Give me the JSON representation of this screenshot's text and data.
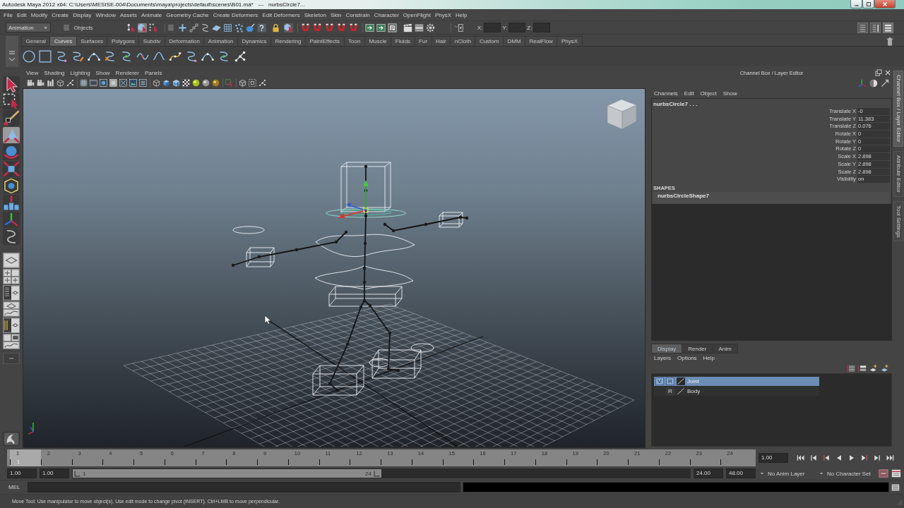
{
  "window": {
    "title": "Autodesk Maya 2012 x64: C:\\Users\\MESISE-004\\Documents\\maya\\projects\\default\\scenes\\B01.ma*   ---   nurbsCircle7..."
  },
  "menu_bar": [
    "File",
    "Edit",
    "Modify",
    "Create",
    "Display",
    "Window",
    "Assets",
    "Animate",
    "Geometry Cache",
    "Create Deformers",
    "Edit Deformers",
    "Skeleton",
    "Skin",
    "Constrain",
    "Character",
    "OpenFlight",
    "PhysX",
    "Help"
  ],
  "status_line": {
    "menu_set": "Animation",
    "selection_field": "Objects",
    "selection_modes": [
      {
        "kind": "hierarchy",
        "selected": false
      },
      {
        "kind": "object",
        "selected": true
      },
      {
        "kind": "component",
        "selected": false
      }
    ],
    "input_labels": [
      "X:",
      "Y:",
      "Z:"
    ]
  },
  "shelf": {
    "tabs": [
      {
        "label": "General",
        "selected": false
      },
      {
        "label": "Curves",
        "selected": true
      },
      {
        "label": "Surfaces",
        "selected": false
      },
      {
        "label": "Polygons",
        "selected": false
      },
      {
        "label": "Subdiv",
        "selected": false
      },
      {
        "label": "Deformation",
        "selected": false
      },
      {
        "label": "Animation",
        "selected": false
      },
      {
        "label": "Dynamics",
        "selected": false
      },
      {
        "label": "Rendering",
        "selected": false
      },
      {
        "label": "PaintEffects",
        "selected": false
      },
      {
        "label": "Toon",
        "selected": false
      },
      {
        "label": "Muscle",
        "selected": false
      },
      {
        "label": "Fluids",
        "selected": false
      },
      {
        "label": "Fur",
        "selected": false
      },
      {
        "label": "Hair",
        "selected": false
      },
      {
        "label": "nCloth",
        "selected": false
      },
      {
        "label": "Custom",
        "selected": false
      },
      {
        "label": "DMM",
        "selected": false
      },
      {
        "label": "RealFlow",
        "selected": false
      },
      {
        "label": "PhysX",
        "selected": false
      }
    ]
  },
  "toolbox": {
    "tools": [
      {
        "kind": "select",
        "selected": false
      },
      {
        "kind": "lasso",
        "selected": false
      },
      {
        "kind": "paint",
        "selected": false
      },
      {
        "kind": "move",
        "selected": true
      },
      {
        "kind": "rotate",
        "selected": false
      },
      {
        "kind": "scale",
        "selected": false
      },
      {
        "kind": "universal",
        "selected": false
      },
      {
        "kind": "soft-mod",
        "selected": false
      },
      {
        "kind": "show-manipulator",
        "selected": false
      },
      {
        "kind": "last-tool",
        "selected": false
      }
    ]
  },
  "viewport": {
    "menus": [
      "View",
      "Shading",
      "Lighting",
      "Show",
      "Renderer",
      "Panels"
    ]
  },
  "channel_box": {
    "title": "Channel Box / Layer Editor",
    "menus": [
      "Channels",
      "Edit",
      "Object",
      "Show"
    ],
    "object_name": "nurbsCircle7 . . .",
    "channels": [
      {
        "name": "Translate X",
        "value": "-0"
      },
      {
        "name": "Translate Y",
        "value": "11.383"
      },
      {
        "name": "Translate Z",
        "value": "0.076"
      },
      {
        "name": "Rotate X",
        "value": "0"
      },
      {
        "name": "Rotate Y",
        "value": "0"
      },
      {
        "name": "Rotate Z",
        "value": "0"
      },
      {
        "name": "Scale X",
        "value": "2.898"
      },
      {
        "name": "Scale Y",
        "value": "2.898"
      },
      {
        "name": "Scale Z",
        "value": "2.898"
      },
      {
        "name": "Visibility",
        "value": "on"
      }
    ],
    "shapes_heading": "SHAPES",
    "shapes": [
      "nurbsCircleShape7"
    ]
  },
  "layer_editor": {
    "tabs": [
      {
        "label": "Display",
        "selected": true
      },
      {
        "label": "Render",
        "selected": false
      },
      {
        "label": "Anim",
        "selected": false
      }
    ],
    "menus": [
      "Layers",
      "Options",
      "Help"
    ],
    "layers": [
      {
        "name": "Joint",
        "visibility": "V",
        "display_type": "R",
        "selected": true
      },
      {
        "name": "Body",
        "display_type": "R",
        "selected": false
      }
    ]
  },
  "side_tabs": [
    {
      "label": "Channel Box / Layer Editor",
      "selected": true
    },
    {
      "label": "Attribute Editor",
      "selected": false
    },
    {
      "label": "Tool Settings",
      "selected": false
    }
  ],
  "time_slider": {
    "frames": [
      {
        "label": "1",
        "selected": true
      },
      {
        "label": "2",
        "selected": false
      },
      {
        "label": "3",
        "selected": false
      },
      {
        "label": "4",
        "selected": false
      },
      {
        "label": "5",
        "selected": false
      },
      {
        "label": "6",
        "selected": false
      },
      {
        "label": "7",
        "selected": false
      },
      {
        "label": "8",
        "selected": false
      },
      {
        "label": "9",
        "selected": false
      },
      {
        "label": "10",
        "selected": false
      },
      {
        "label": "11",
        "selected": false
      },
      {
        "label": "12",
        "selected": false
      },
      {
        "label": "13",
        "selected": false
      },
      {
        "label": "14",
        "selected": false
      },
      {
        "label": "15",
        "selected": false
      },
      {
        "label": "16",
        "selected": false
      },
      {
        "label": "17",
        "selected": false
      },
      {
        "label": "18",
        "selected": false
      },
      {
        "label": "19",
        "selected": false
      },
      {
        "label": "20",
        "selected": false
      },
      {
        "label": "21",
        "selected": false
      },
      {
        "label": "22",
        "selected": false
      },
      {
        "label": "23",
        "selected": false
      },
      {
        "label": "24",
        "selected": false
      }
    ],
    "current_frame": "1",
    "current_time": "1.00"
  },
  "range_slider": {
    "start_time": "1.00",
    "playback_start": "1.00",
    "range_start": "1",
    "range_end": "24",
    "level": 0.5,
    "playback_end": "24.00",
    "end_time": "48.00",
    "anim_layer": "No Anim Layer",
    "character_set": "No Character Set"
  },
  "command_line": {
    "language": "MEL"
  },
  "help_line": "Move Tool: Use manipulator to move object(s). Use edit mode to change pivot (INSERT).  Ctrl+LMB to move perpendicular."
}
